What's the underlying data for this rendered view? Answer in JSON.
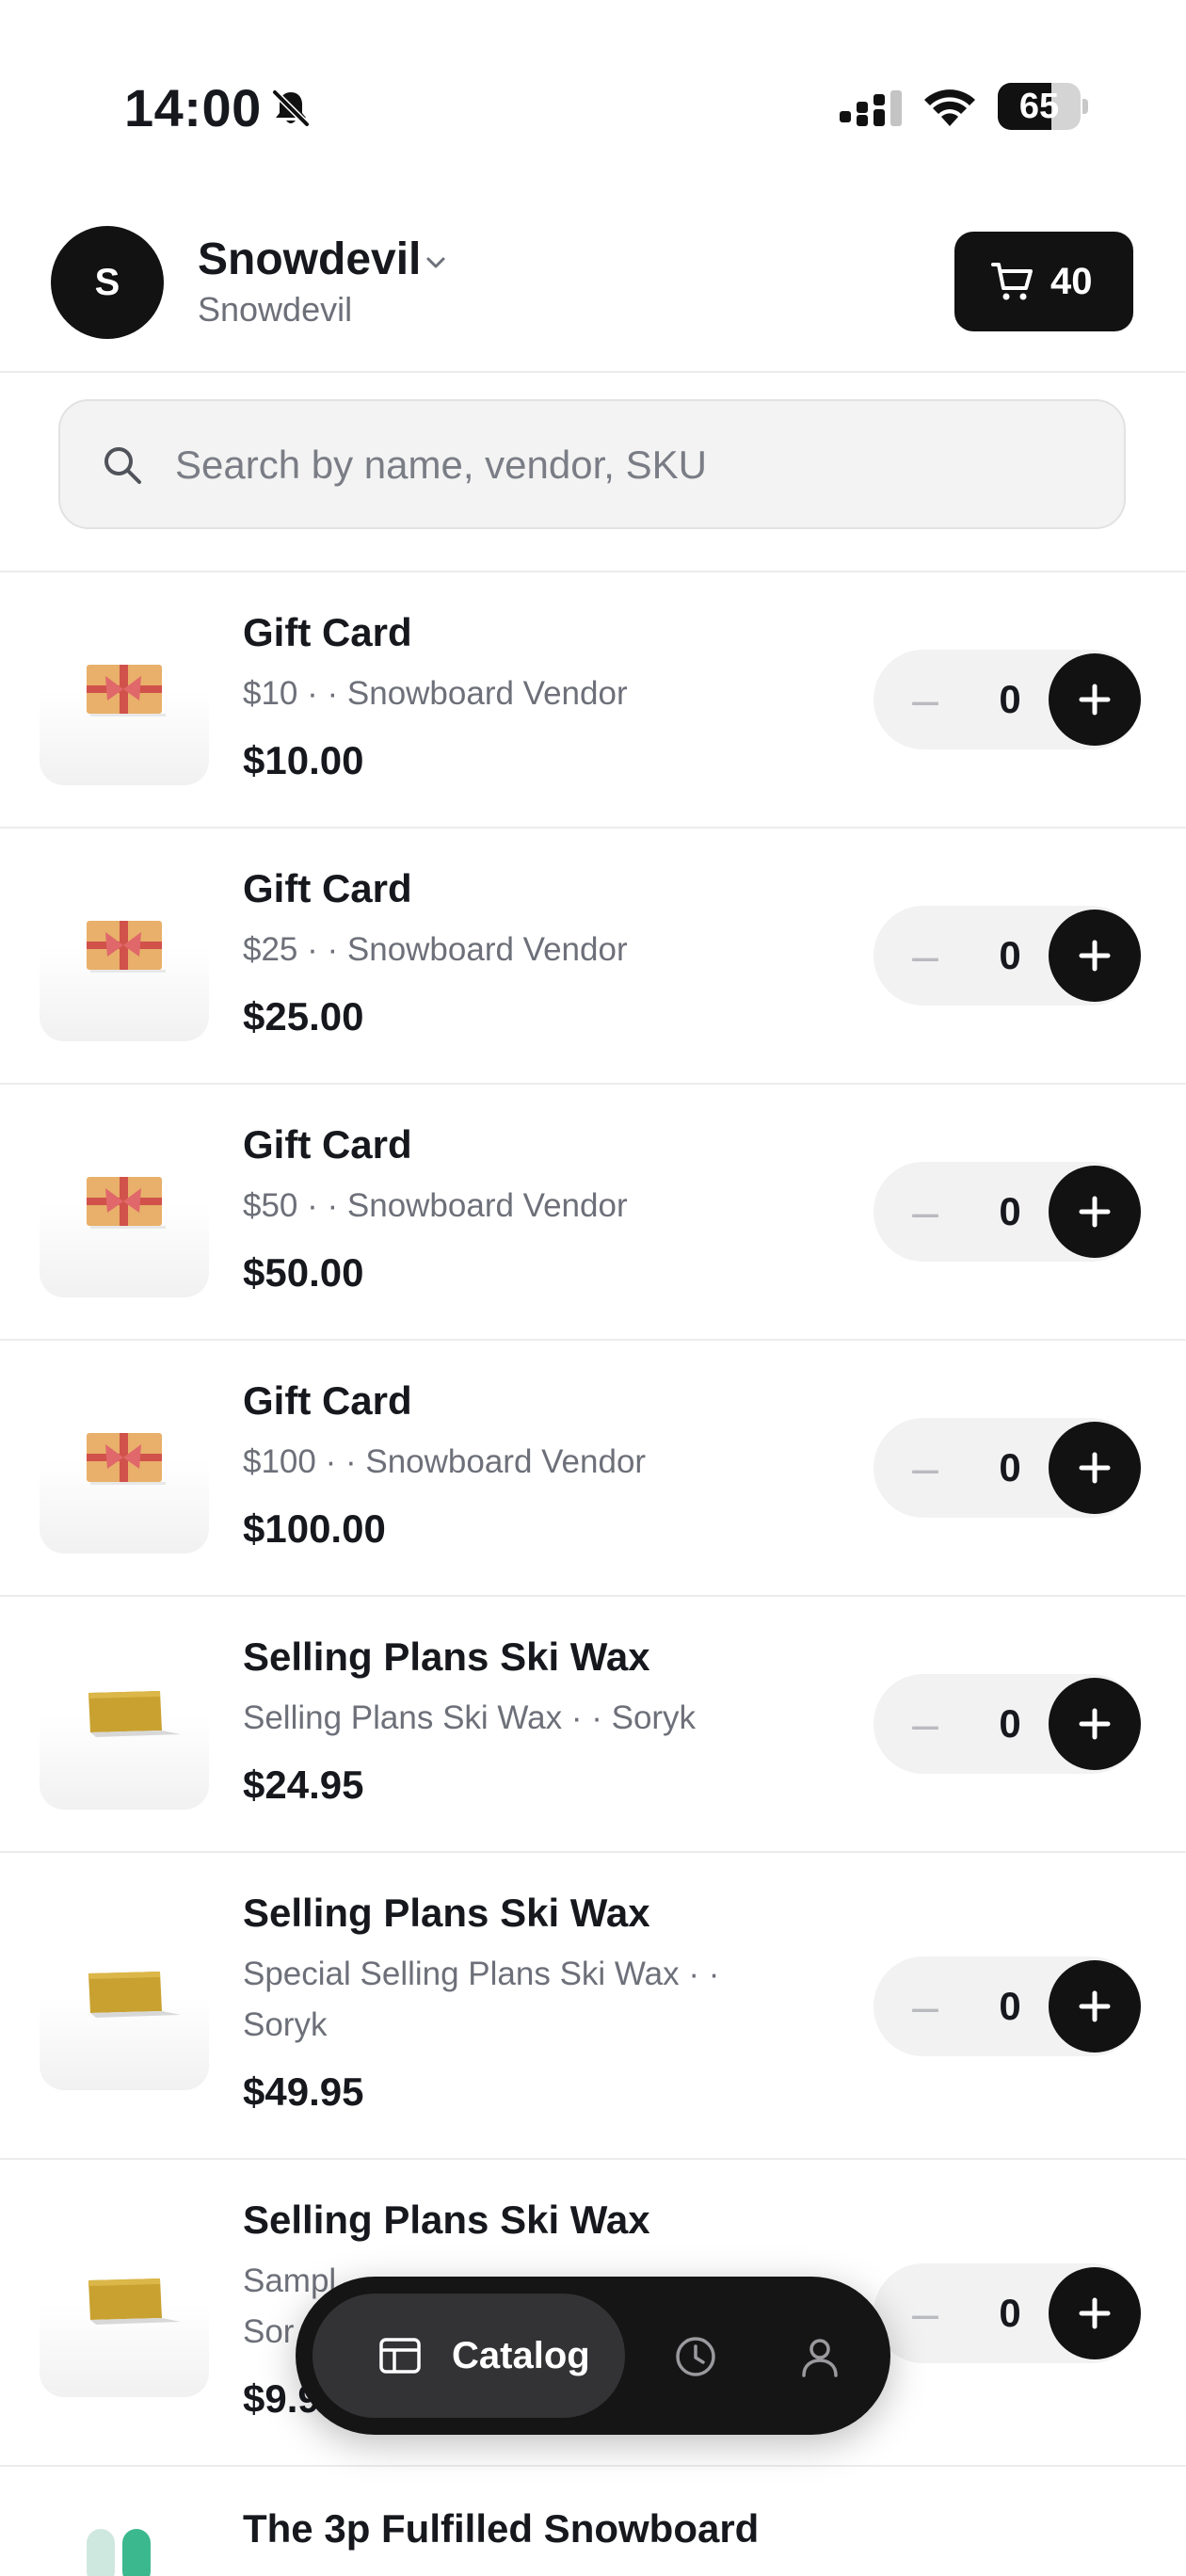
{
  "status_bar": {
    "time": "14:00",
    "battery_level": "65",
    "battery_fraction": 0.65,
    "icons": [
      "bell-slash-icon",
      "cellular-signal-icon",
      "wifi-icon",
      "battery-icon"
    ]
  },
  "header": {
    "avatar_initial": "S",
    "shop_name": "Snowdevil",
    "shop_subtitle": "Snowdevil",
    "cart_count": "40",
    "icons": [
      "chevron-down-icon",
      "cart-icon"
    ]
  },
  "search": {
    "placeholder": "Search by name, vendor, SKU",
    "value": "",
    "icon": "search-icon"
  },
  "products": [
    {
      "title": "Gift Card",
      "subtitle": "$10 · · Snowboard Vendor",
      "price": "$10.00",
      "qty": "0",
      "image": "gift-card"
    },
    {
      "title": "Gift Card",
      "subtitle": "$25 · · Snowboard Vendor",
      "price": "$25.00",
      "qty": "0",
      "image": "gift-card"
    },
    {
      "title": "Gift Card",
      "subtitle": "$50 · · Snowboard Vendor",
      "price": "$50.00",
      "qty": "0",
      "image": "gift-card"
    },
    {
      "title": "Gift Card",
      "subtitle": "$100 · · Snowboard Vendor",
      "price": "$100.00",
      "qty": "0",
      "image": "gift-card"
    },
    {
      "title": "Selling Plans Ski Wax",
      "subtitle": "Selling Plans Ski Wax · · Soryk",
      "price": "$24.95",
      "qty": "0",
      "image": "ski-wax"
    },
    {
      "title": "Selling Plans Ski Wax",
      "subtitle": "Special Selling Plans Ski Wax · · Soryk",
      "price": "$49.95",
      "qty": "0",
      "image": "ski-wax"
    },
    {
      "title": "Selling Plans Ski Wax",
      "subtitle": "Sampl Sor",
      "price": "$9.9",
      "qty": "0",
      "image": "ski-wax"
    },
    {
      "title": "The 3p Fulfilled Snowboard",
      "subtitle": "",
      "price": "",
      "qty": "",
      "image": "snowboard"
    }
  ],
  "stepper": {
    "minus_label": "–"
  },
  "tabbar": {
    "catalog_label": "Catalog",
    "icons": [
      "catalog-icon",
      "history-clock-icon",
      "account-person-icon"
    ]
  },
  "colors": {
    "primary_dark": "#121212",
    "text": "#16181d",
    "muted": "#6d7079",
    "stepper_bg": "#f2f2f2",
    "divider": "#ececec"
  }
}
